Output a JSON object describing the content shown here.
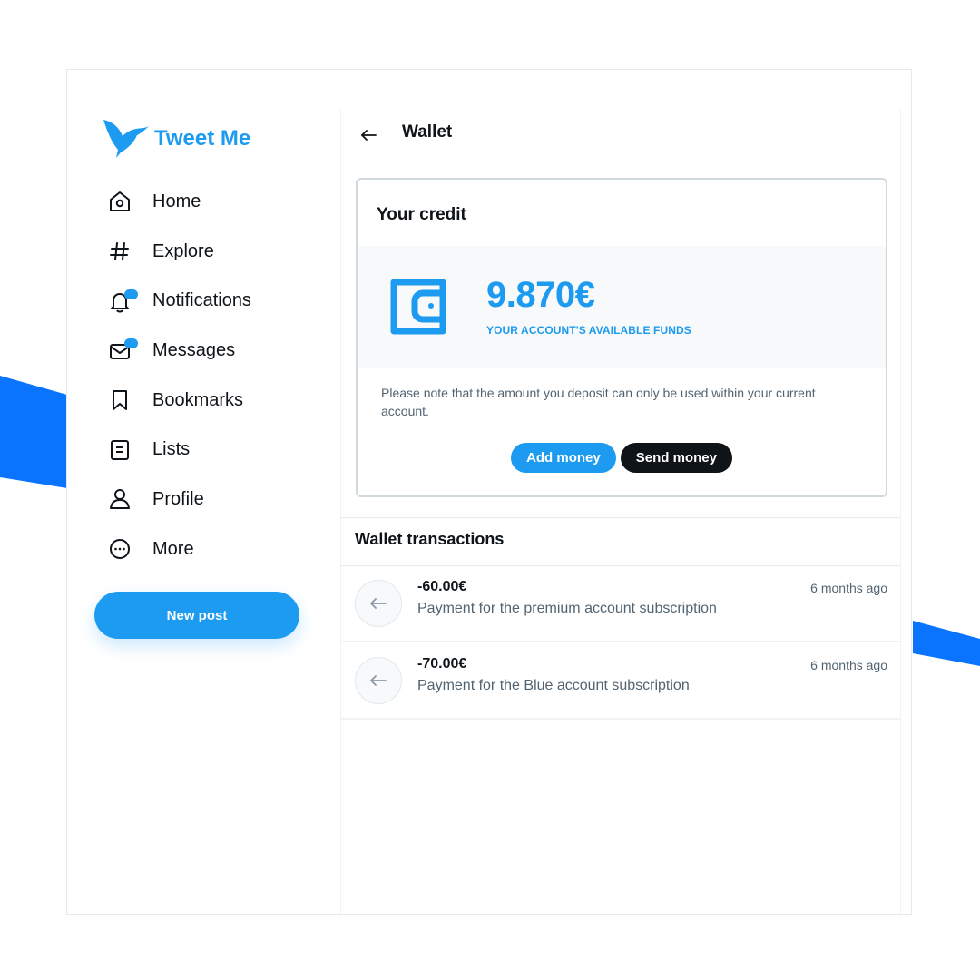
{
  "colors": {
    "accent": "#1d9bf0",
    "dark": "#0f1419",
    "muted": "#536471",
    "decoration": "#0a74ff"
  },
  "app": {
    "name": "Tweet Me",
    "logo_icon": "hummingbird-icon"
  },
  "sidebar": {
    "items": [
      {
        "label": "Home",
        "icon": "home-icon"
      },
      {
        "label": "Explore",
        "icon": "hashtag-icon"
      },
      {
        "label": "Notifications",
        "icon": "bell-icon",
        "badge": true
      },
      {
        "label": "Messages",
        "icon": "envelope-icon",
        "badge": true
      },
      {
        "label": "Bookmarks",
        "icon": "bookmark-icon"
      },
      {
        "label": "Lists",
        "icon": "list-icon"
      },
      {
        "label": "Profile",
        "icon": "person-icon"
      },
      {
        "label": "More",
        "icon": "more-circle-icon"
      }
    ],
    "new_post_label": "New post"
  },
  "header": {
    "title": "Wallet",
    "back_icon": "arrow-left-icon"
  },
  "credit": {
    "title": "Your credit",
    "amount": "9.870€",
    "caption": "YOUR ACCOUNT'S AVAILABLE FUNDS",
    "note": "Please note that the amount you deposit can only be used within your current account.",
    "add_label": "Add money",
    "send_label": "Send money",
    "icon": "wallet-icon"
  },
  "transactions": {
    "title": "Wallet transactions",
    "items": [
      {
        "amount": "-60.00€",
        "description": "Payment for the premium account subscription",
        "time": "6 months ago",
        "icon": "arrow-left-icon"
      },
      {
        "amount": "-70.00€",
        "description": "Payment for the Blue account subscription",
        "time": "6 months ago",
        "icon": "arrow-left-icon"
      }
    ]
  }
}
